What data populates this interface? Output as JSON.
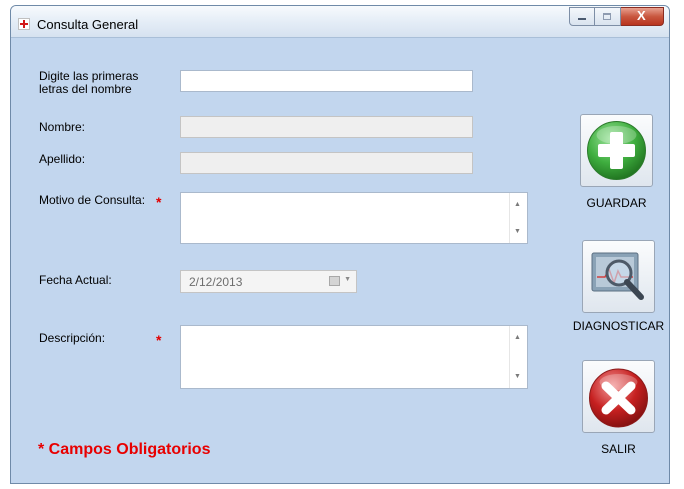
{
  "window": {
    "title": "Consulta General",
    "close_glyph": "X"
  },
  "form": {
    "search_label": "Digite las primeras letras del nombre",
    "search_value": "",
    "nombre_label": "Nombre:",
    "nombre_value": "",
    "apellido_label": "Apellido:",
    "apellido_value": "",
    "motivo_label": "Motivo de Consulta:",
    "motivo_value": "",
    "fecha_label": "Fecha Actual:",
    "fecha_value": "2/12/2013",
    "descripcion_label": "Descripción:",
    "descripcion_value": "",
    "required_marker": "*",
    "required_note": "* Campos Obligatorios"
  },
  "buttons": {
    "guardar": "GUARDAR",
    "diagnosticar": "DIAGNOSTICAR",
    "salir": "SALIR"
  },
  "colors": {
    "form_background": "#c2d6ee",
    "required": "#e80000",
    "guardar_icon": "#3fae3f",
    "salir_icon": "#c62020"
  },
  "icons": {
    "guardar": "plus-icon",
    "diagnosticar": "magnifier-monitor-icon",
    "salir": "x-icon",
    "app": "red-cross-icon"
  }
}
